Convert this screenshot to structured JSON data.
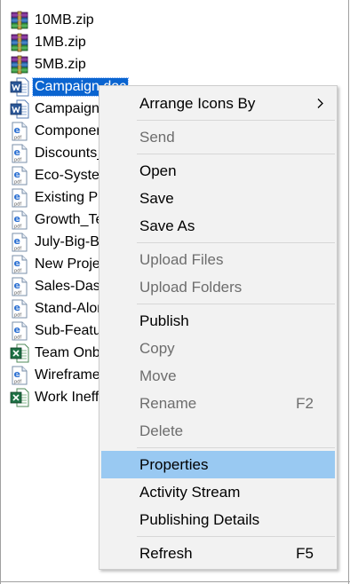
{
  "files": [
    {
      "name": "10MB.zip",
      "icon": "winrar-archive-icon",
      "selected": false
    },
    {
      "name": "1MB.zip",
      "icon": "winrar-archive-icon",
      "selected": false
    },
    {
      "name": "5MB.zip",
      "icon": "winrar-archive-icon",
      "selected": false
    },
    {
      "name": "Campaign.doc",
      "icon": "word-document-icon",
      "selected": true
    },
    {
      "name": "Campaigns",
      "icon": "word-document-icon",
      "selected": false
    },
    {
      "name": "Componen",
      "icon": "ie-pdf-icon",
      "selected": false
    },
    {
      "name": "Discounts_",
      "icon": "ie-pdf-icon",
      "selected": false
    },
    {
      "name": "Eco-Syste",
      "icon": "ie-pdf-icon",
      "selected": false
    },
    {
      "name": "Existing Pr",
      "icon": "ie-pdf-icon",
      "selected": false
    },
    {
      "name": "Growth_Te",
      "icon": "ie-pdf-icon",
      "selected": false
    },
    {
      "name": "July-Big-Bu",
      "icon": "ie-pdf-icon",
      "selected": false
    },
    {
      "name": "New Projec",
      "icon": "ie-pdf-icon",
      "selected": false
    },
    {
      "name": "Sales-Das",
      "icon": "ie-pdf-icon",
      "selected": false
    },
    {
      "name": "Stand-Alon",
      "icon": "ie-pdf-icon",
      "selected": false
    },
    {
      "name": "Sub-Featu",
      "icon": "ie-pdf-icon",
      "selected": false
    },
    {
      "name": "Team Onb",
      "icon": "excel-document-icon",
      "selected": false
    },
    {
      "name": "Wireframe",
      "icon": "ie-pdf-icon",
      "selected": false
    },
    {
      "name": "Work Ineff",
      "icon": "excel-document-icon",
      "selected": false
    }
  ],
  "menu": {
    "arrange_icons_by": "Arrange Icons By",
    "send": "Send",
    "open": "Open",
    "save": "Save",
    "save_as": "Save As",
    "upload_files": "Upload Files",
    "upload_folders": "Upload Folders",
    "publish": "Publish",
    "copy": "Copy",
    "move": "Move",
    "rename": "Rename",
    "rename_shortcut": "F2",
    "delete": "Delete",
    "properties": "Properties",
    "activity_stream": "Activity Stream",
    "publishing_details": "Publishing Details",
    "refresh": "Refresh",
    "refresh_shortcut": "F5"
  },
  "colors": {
    "selection": "#0a64d0",
    "menu_highlight": "#99c9f2",
    "menu_background": "#f2f2f2",
    "disabled_text": "#6d6d6d"
  }
}
